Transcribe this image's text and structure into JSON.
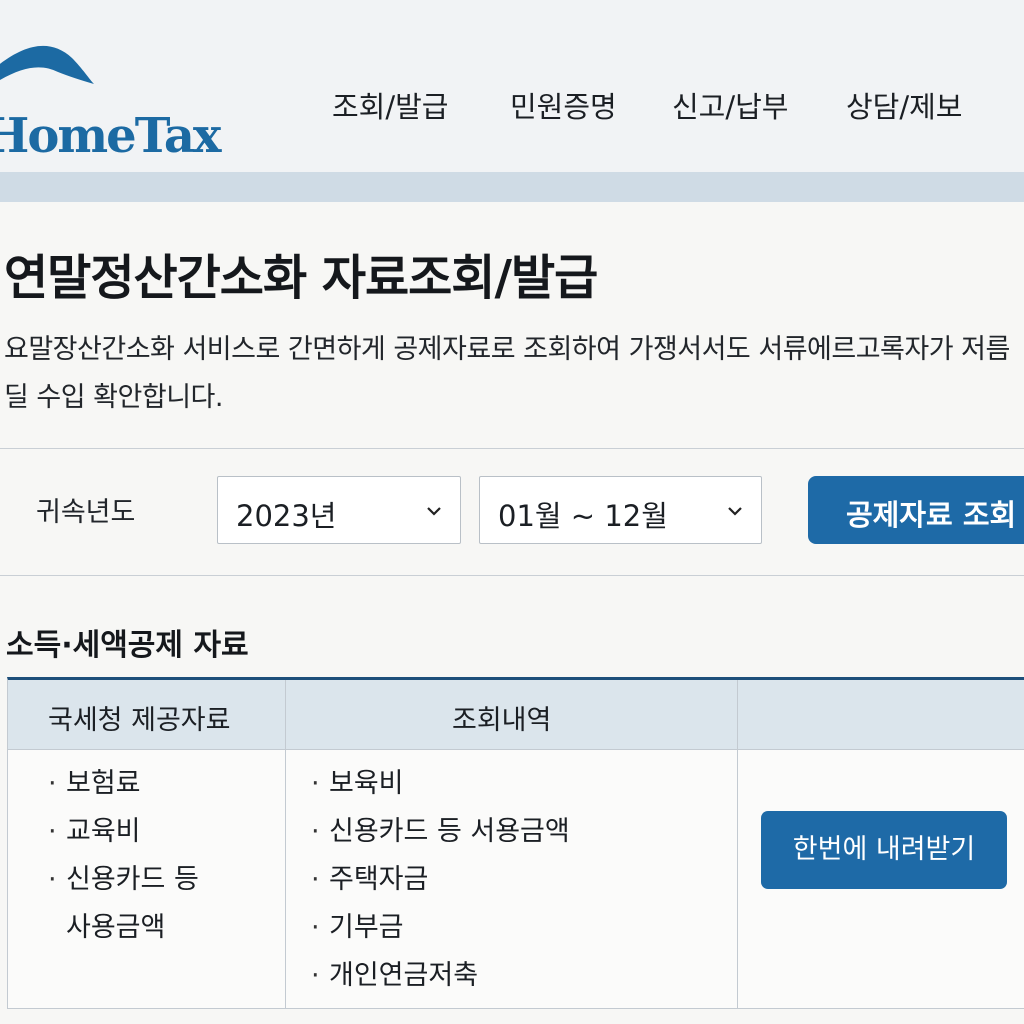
{
  "header": {
    "logo_text": "HomeTax",
    "nav": [
      "조회/발급",
      "민원증명",
      "신고/납부",
      "상담/제보"
    ]
  },
  "page": {
    "title": "연말정산간소화 자료조회/발급",
    "description": "요말장산간소화 서비스로 간면하게 공제자료로 조회하여 가쟁서서도 서류에르고록자가 저름딜 수입 확안합니다."
  },
  "filter": {
    "label": "귀속년도",
    "year": "2023년",
    "period": "01월 ~ 12월",
    "search_button": "공제자료 조회"
  },
  "section": {
    "title": "소득·세액공제 자료",
    "headers": [
      "국세청 제공자료",
      "조회내역",
      ""
    ],
    "provided": [
      "보험료",
      "교육비",
      "신용카드 등",
      "사용금액"
    ],
    "history": [
      "보육비",
      "신용카드 등 서용금액",
      "주택자금",
      "기부금",
      "개인연금저축"
    ],
    "download_button": "한번에 내려받기"
  },
  "colors": {
    "brand": "#1e6aa7",
    "header_band": "#cfdbe5",
    "table_header": "#dbe5ec",
    "table_top_border": "#1d4f7a"
  }
}
